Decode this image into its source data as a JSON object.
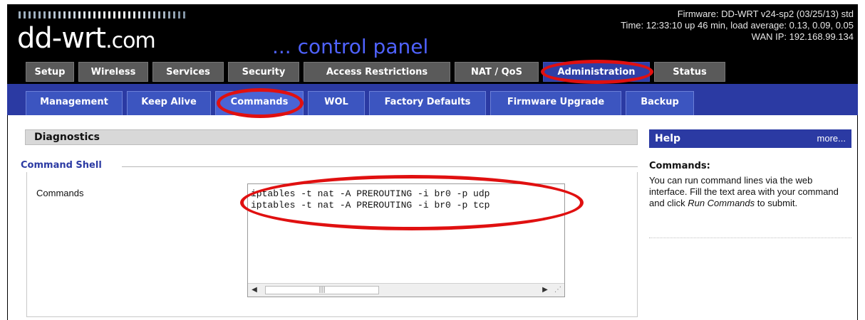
{
  "brand": {
    "logo_main": "dd-wrt",
    "logo_suffix": ".com",
    "tagline": "... control panel"
  },
  "header_info": {
    "firmware": "Firmware: DD-WRT v24-sp2 (03/25/13) std",
    "time": "Time: 12:33:10 up 46 min, load average: 0.13, 0.09, 0.05",
    "wan_ip": "WAN IP: 192.168.99.134"
  },
  "main_tabs": [
    {
      "label": "Setup"
    },
    {
      "label": "Wireless"
    },
    {
      "label": "Services"
    },
    {
      "label": "Security"
    },
    {
      "label": "Access Restrictions"
    },
    {
      "label": "NAT / QoS"
    },
    {
      "label": "Administration",
      "active": true
    },
    {
      "label": "Status"
    }
  ],
  "sub_tabs": [
    {
      "label": "Management"
    },
    {
      "label": "Keep Alive"
    },
    {
      "label": "Commands",
      "active": true
    },
    {
      "label": "WOL"
    },
    {
      "label": "Factory Defaults"
    },
    {
      "label": "Firmware Upgrade"
    },
    {
      "label": "Backup"
    }
  ],
  "section": {
    "title": "Diagnostics",
    "fieldset_legend": "Command Shell",
    "commands_label": "Commands",
    "command_lines": [
      "iptables -t nat -A PREROUTING -i br0 -p udp",
      "iptables -t nat -A PREROUTING -i br0 -p tcp"
    ]
  },
  "help": {
    "header": "Help",
    "more": "more...",
    "title": "Commands:",
    "text_pre": "You can run command lines via the web interface. Fill the text area with your command and click ",
    "text_em": "Run Commands",
    "text_post": " to submit."
  },
  "colors": {
    "header_bg": "#000000",
    "active_main_tab": "#2f3fa6",
    "sub_bar": "#2b3aa3",
    "annotation": "#e01010"
  }
}
